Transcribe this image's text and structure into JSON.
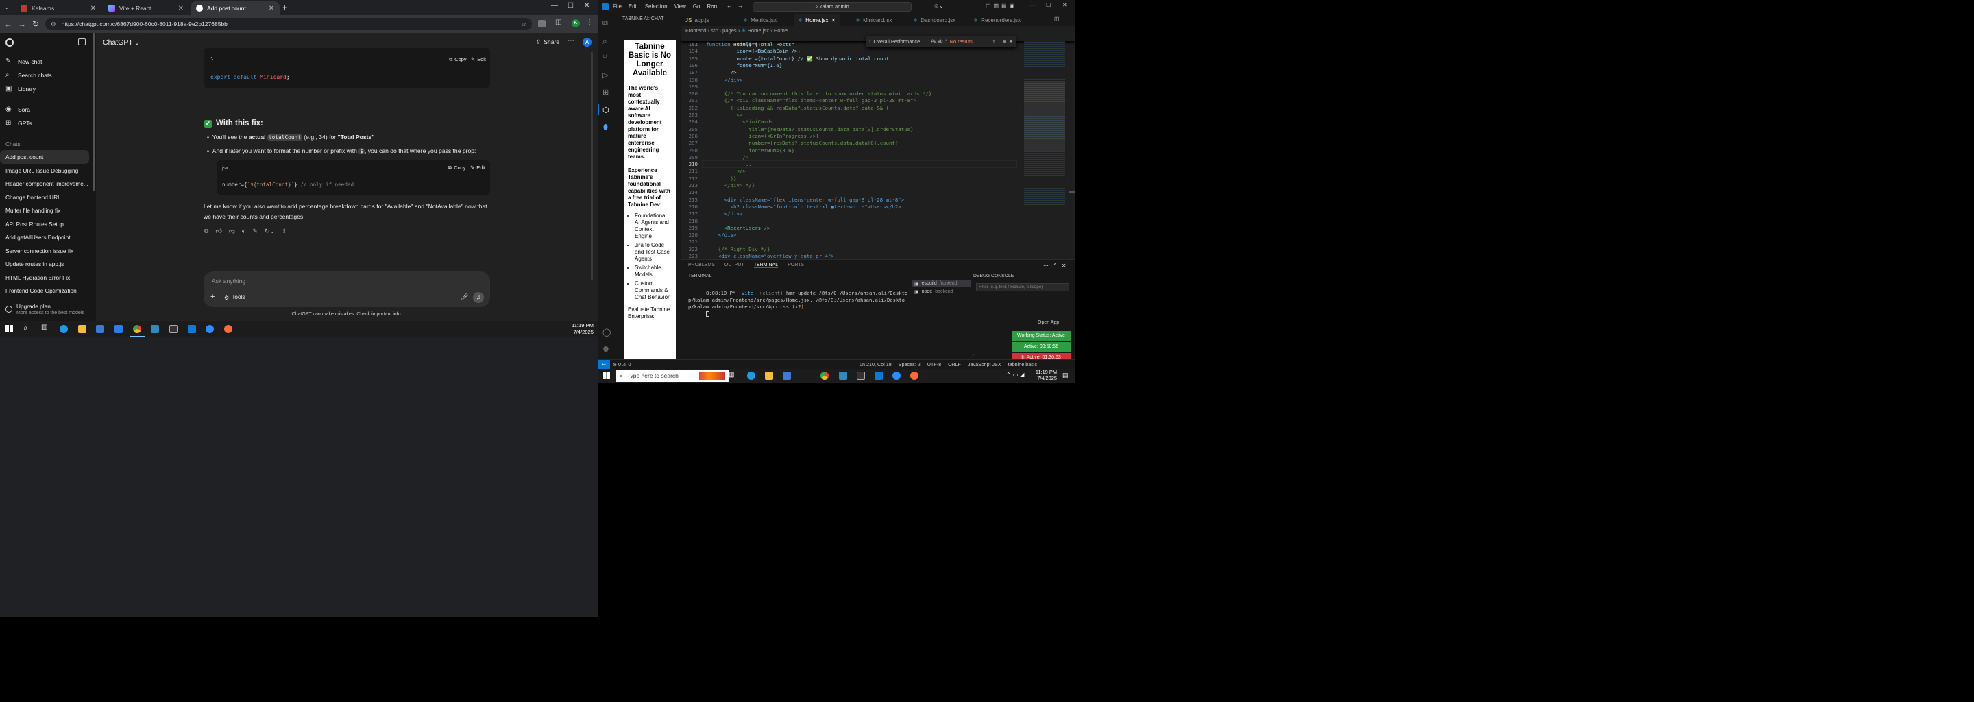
{
  "chrome": {
    "tabs": [
      {
        "title": "Kalaams"
      },
      {
        "title": "Vite + React"
      },
      {
        "title": "Add post count"
      }
    ],
    "url": "https://chatgpt.com/c/6867d900-60c0-8011-918a-9e2b127685bb"
  },
  "chatgpt": {
    "sidebar": {
      "new_chat": "New chat",
      "search_chats": "Search chats",
      "library": "Library",
      "sora": "Sora",
      "gpts": "GPTs",
      "chats_heading": "Chats",
      "chats": [
        "Add post count",
        "Image URL Issue Debugging",
        "Header component improveme...",
        "Change frontend URL",
        "Multer file handling fix",
        "API Post Routes Setup",
        "Add getAllUsers Endpoint",
        "Server connection issue fix",
        "Update routes in app.js",
        "HTML Hydration Error Fix",
        "Frontend Code Optimization"
      ],
      "upgrade_title": "Upgrade plan",
      "upgrade_sub": "More access to the best models"
    },
    "header": {
      "model": "ChatGPT",
      "share": "Share",
      "avatar": "A"
    },
    "code1": {
      "brace": "}",
      "export_kw": "export",
      "default_kw": "default",
      "name": "Minicard",
      "semi": ";"
    },
    "copy_label": "Copy",
    "edit_label": "Edit",
    "fix_heading": "With this fix:",
    "bullet1": {
      "pre": "You'll see the ",
      "bold": "actual",
      "code": "totalCount",
      "mid": " (e.g., 34) for ",
      "quote": "\"Total Posts\""
    },
    "bullet2": {
      "pre": "And if later you want to format the number or prefix with ",
      "code": "$",
      "post": ", you can do that where you pass the prop:"
    },
    "code2": {
      "lang": "jsx",
      "attr": "numberFooter",
      "prop": "number",
      "tpl": "`${totalCount}`",
      "comment": "// only if needed"
    },
    "followup": "Let me know if you also want to add percentage breakdown cards for \"Available\" and \"NotAvailable\" now that we have their counts and percentages!",
    "input_placeholder": "Ask anything",
    "tools_label": "Tools",
    "disclaimer": "ChatGPT can make mistakes. Check important info."
  },
  "taskbar_left": {
    "time": "11:19 PM",
    "date": "7/4/2025"
  },
  "vscode": {
    "menu": [
      "File",
      "Edit",
      "Selection",
      "View",
      "Go",
      "Run"
    ],
    "search": "kalam admin",
    "tabnine_title": "TABNINE AI: CHAT",
    "tabnine": {
      "heading": "Tabnine Basic is No Longer Available",
      "p1": "The world's most contextually aware AI software development platform for mature enterprise engineering teams.",
      "p2": "Experience Tabnine's foundational capabilities with a free trial of Tabnine Dev:",
      "list": [
        "Foundational AI Agents and Context Engine",
        "Jira to Code and Test Case Agents",
        "Switchable Models",
        "Custom Commands & Chat Behavior"
      ],
      "p3": "Evaluate Tabnine Enterprise:"
    },
    "tabs": [
      "app.js",
      "Metrics.jsx",
      "Home.jsx",
      "Minicard.jsx",
      "Dashboard.jsx",
      "Recenorders.jsx"
    ],
    "breadcrumb": [
      "Frontend",
      "src",
      "pages",
      "Home.jsx",
      "Home"
    ],
    "sticky": {
      "num": "141",
      "kw": "function",
      "fn": "Home",
      "rest": "() {"
    },
    "find": {
      "query": "Overall Performance",
      "result": "No results"
    },
    "lines": [
      {
        "n": "193",
        "t": "          title=\"Total Posts\""
      },
      {
        "n": "194",
        "t": "          icon={<BsCashCoin />}"
      },
      {
        "n": "195",
        "t": "          number={totalCount} // ✅ Show dynamic total count"
      },
      {
        "n": "196",
        "t": "          footerNum={1.6}"
      },
      {
        "n": "197",
        "t": "        />"
      },
      {
        "n": "198",
        "t": "      </div>"
      },
      {
        "n": "199",
        "t": ""
      },
      {
        "n": "200",
        "t": "      {/* You can uncomment this later to show order status mini cards */}"
      },
      {
        "n": "201",
        "t": "      {/* <div className=\"flex items-center w-full gap-3 pl-28 mt-8\">"
      },
      {
        "n": "202",
        "t": "        {!isLoading && resData?.statusCounts.data?.data && ("
      },
      {
        "n": "203",
        "t": "          <>"
      },
      {
        "n": "204",
        "t": "            <MiniCards"
      },
      {
        "n": "205",
        "t": "              title={resData?.statusCounts.data.data[0].orderStatus}"
      },
      {
        "n": "206",
        "t": "              icon={<GrInProgress />}"
      },
      {
        "n": "207",
        "t": "              number={resData?.statusCounts.data.data[0].count}"
      },
      {
        "n": "208",
        "t": "              footerNum={3.6}"
      },
      {
        "n": "209",
        "t": "            />"
      },
      {
        "n": "210",
        "t": "            ..."
      },
      {
        "n": "211",
        "t": "          </>"
      },
      {
        "n": "212",
        "t": "        )}"
      },
      {
        "n": "213",
        "t": "      </div> */}"
      },
      {
        "n": "214",
        "t": ""
      },
      {
        "n": "215",
        "t": "      <div className=\"flex items-center w-full gap-3 pl-28 mt-8\">"
      },
      {
        "n": "216",
        "t": "        <h2 className=\"font-bold text-xl ■text-white\">Users</h2>"
      },
      {
        "n": "217",
        "t": "      </div>"
      },
      {
        "n": "218",
        "t": ""
      },
      {
        "n": "219",
        "t": "      <RecentUsers />"
      },
      {
        "n": "220",
        "t": "    </div>"
      },
      {
        "n": "221",
        "t": ""
      },
      {
        "n": "222",
        "t": "    {/* Right Div */}"
      },
      {
        "n": "223",
        "t": "    <div className=\"overflow-y-auto pr-4\">"
      }
    ],
    "panel_tabs": [
      "PROBLEMS",
      "OUTPUT",
      "TERMINAL",
      "PORTS"
    ],
    "terminal_label": "TERMINAL",
    "debug_label": "DEBUG CONSOLE",
    "debug_filter": "Filter (e.g. text, !exclude, \\escape)",
    "terminal": {
      "time": "8:08:10 PM",
      "tag": "[vite]",
      "client": "(client)",
      "msg": "hmr update",
      "path1": "/@fs/C:/Users/ahsan.ali/Desktop/kalam admin/Fr",
      "path2": "ontend/src/pages/Home.jsx, /@fs/C:/Users/ahsan.ali/Desktop/kalam admin/Frontend/src/",
      "path3": "App.css",
      "count": "(x2)"
    },
    "terminals": [
      {
        "name": "esbuild",
        "folder": "frontend"
      },
      {
        "name": "node",
        "folder": "backend"
      }
    ],
    "open_app": "Open App",
    "working_status": "Working Status: Active",
    "active_time": "Active: 03:50:56",
    "inactive_time": "In Active: 01:30:53",
    "status": {
      "errors": "0",
      "warnings": "0",
      "position": "Ln 210, Col 18",
      "spaces": "Spaces: 2",
      "encoding": "UTF-8",
      "eol": "CRLF",
      "lang": "JavaScript JSX",
      "tabnine": "tabnine basic",
      "prettier": "Prettier"
    }
  },
  "taskbar_right": {
    "search": "Type here to search",
    "time": "11:19 PM",
    "date": "7/4/2025"
  }
}
